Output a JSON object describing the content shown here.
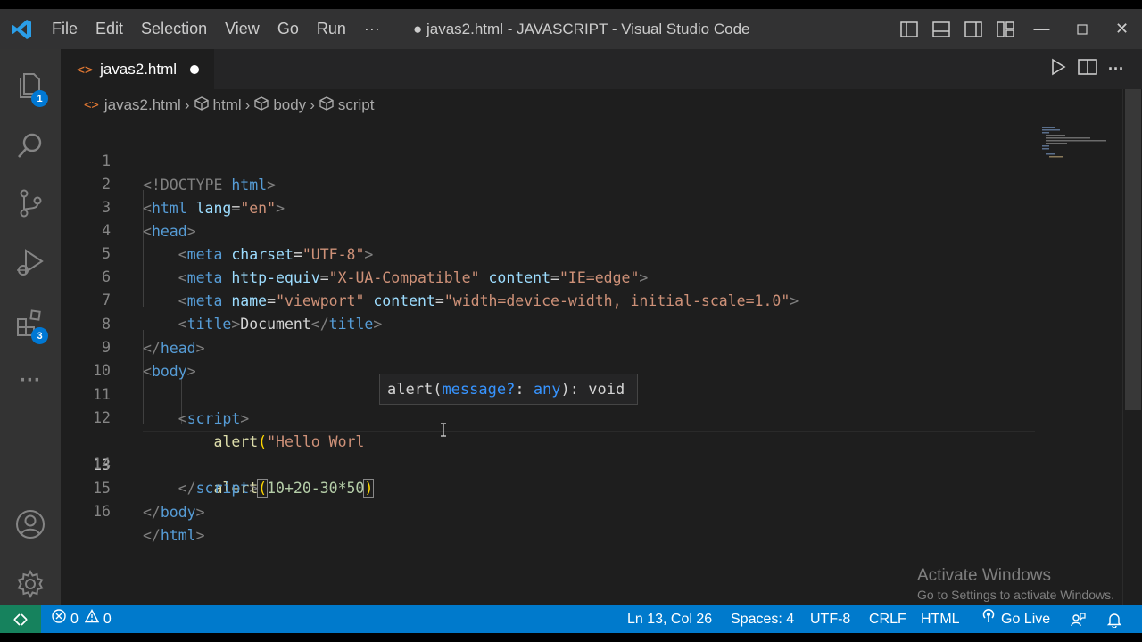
{
  "window": {
    "title": "● javas2.html - JAVASCRIPT - Visual Studio Code",
    "menu": [
      "File",
      "Edit",
      "Selection",
      "View",
      "Go",
      "Run",
      "···"
    ]
  },
  "activity_bar": {
    "explorer_badge": "1",
    "extensions_badge": "3"
  },
  "tab": {
    "label": "javas2.html"
  },
  "breadcrumb": [
    "javas2.html",
    "html",
    "body",
    "script"
  ],
  "editor": {
    "lines": [
      {
        "n": "1"
      },
      {
        "n": "2"
      },
      {
        "n": "3"
      },
      {
        "n": "4"
      },
      {
        "n": "5"
      },
      {
        "n": "6"
      },
      {
        "n": "7"
      },
      {
        "n": "8"
      },
      {
        "n": "9"
      },
      {
        "n": "10"
      },
      {
        "n": "11"
      },
      {
        "n": "12"
      },
      {
        "n": "13"
      },
      {
        "n": "14"
      },
      {
        "n": "15"
      },
      {
        "n": "16"
      }
    ],
    "code": {
      "l1_doctype": "<!DOCTYPE",
      "l1_html": " html",
      "l1_end": ">",
      "l2_tag": "html",
      "l2_attr": "lang",
      "l2_val": "\"en\"",
      "l3_tag": "head",
      "l4_tag": "meta",
      "l4_attr": "charset",
      "l4_val": "\"UTF-8\"",
      "l5_tag": "meta",
      "l5_attr1": "http-equiv",
      "l5_val1": "\"X-UA-Compatible\"",
      "l5_attr2": "content",
      "l5_val2": "\"IE=edge\"",
      "l6_tag": "meta",
      "l6_attr1": "name",
      "l6_val1": "\"viewport\"",
      "l6_attr2": "content",
      "l6_val2": "\"width=device-width, initial-scale=1.0\"",
      "l7_tag": "title",
      "l7_text": "Document",
      "l8_tag": "head",
      "l9_tag": "body",
      "l11_tag": "script",
      "l12_fn": "alert",
      "l12_str": "\"Hello Worl",
      "l13_fn": "alert",
      "l13_expr": "10+20-30*50",
      "l14_tag": "script",
      "l15_tag": "body",
      "l16_tag": "html"
    },
    "hover": {
      "fn": "alert",
      "param": "message?",
      "colon": ": ",
      "type": "any",
      "ret": "): void"
    }
  },
  "watermark": {
    "line1": "Activate Windows",
    "line2": "Go to Settings to activate Windows."
  },
  "status_bar": {
    "errors": "0",
    "warnings": "0",
    "position": "Ln 13, Col 26",
    "spaces": "Spaces: 4",
    "encoding": "UTF-8",
    "eol": "CRLF",
    "language": "HTML",
    "golive": "Go Live"
  },
  "colors": {
    "statusbar": "#007acc",
    "activitybar": "#333333",
    "editor_bg": "#1e1e1e",
    "badge": "#0078d4"
  }
}
